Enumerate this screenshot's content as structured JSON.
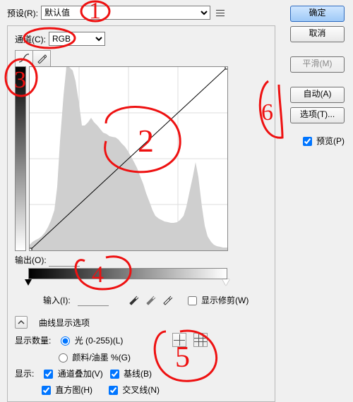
{
  "preset": {
    "label": "预设(R):",
    "value": "默认值"
  },
  "buttons": {
    "ok": "确定",
    "cancel": "取消",
    "smooth": "平滑(M)",
    "auto": "自动(A)",
    "options": "选项(T)..."
  },
  "preview": {
    "label": "预览(P)",
    "checked": true
  },
  "channel": {
    "label": "通道(C):",
    "value": "RGB"
  },
  "output": {
    "label": "输出(O):",
    "value": ""
  },
  "input": {
    "label": "输入(I):",
    "value": ""
  },
  "show_clip": {
    "label": "显示修剪(W)",
    "checked": false
  },
  "curve_opts_title": "曲线显示选项",
  "amount": {
    "label": "显示数量:",
    "light": "光 (0-255)(L)",
    "pigment": "颜料/油墨 %(G)",
    "selected": "light"
  },
  "show": {
    "label": "显示:",
    "overlay": "通道叠加(V)",
    "hist": "直方图(H)",
    "baseline": "基线(B)",
    "intersect": "交叉线(N)"
  },
  "checks": {
    "overlay": true,
    "hist": true,
    "baseline": true,
    "intersect": true
  },
  "annotations": [
    "1",
    "2",
    "3",
    "4",
    "5",
    "6"
  ],
  "chart_data": {
    "type": "line",
    "title": "",
    "xlabel": "输入",
    "ylabel": "输出",
    "xlim": [
      0,
      255
    ],
    "ylim": [
      0,
      255
    ],
    "series": [
      {
        "name": "curve",
        "x": [
          0,
          255
        ],
        "y": [
          0,
          255
        ]
      }
    ],
    "histogram": {
      "x_range": [
        0,
        255
      ],
      "values": [
        8,
        12,
        15,
        18,
        22,
        28,
        35,
        45,
        60,
        90,
        150,
        210,
        250,
        250,
        245,
        230,
        200,
        170,
        170,
        175,
        180,
        175,
        170,
        165,
        160,
        158,
        156,
        155,
        153,
        150,
        145,
        140,
        135,
        128,
        120,
        112,
        100,
        90,
        78,
        66,
        55,
        48,
        44,
        42,
        40,
        39,
        38,
        38,
        39,
        42,
        48,
        60,
        78,
        100,
        120,
        100,
        60,
        34,
        20,
        12,
        8,
        6,
        5,
        4
      ]
    }
  }
}
